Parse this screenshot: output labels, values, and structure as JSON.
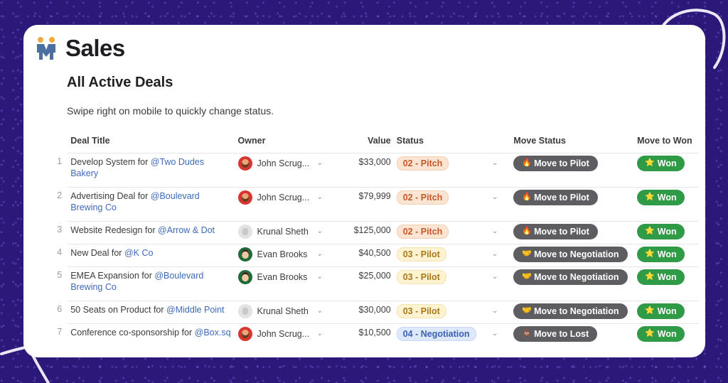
{
  "app": {
    "title": "Sales",
    "logo_icon": "handshake-people-icon"
  },
  "page": {
    "title": "All Active Deals",
    "subtitle": "Swipe right on mobile to quickly change status."
  },
  "table": {
    "columns": {
      "title": "Deal Title",
      "owner": "Owner",
      "value": "Value",
      "status": "Status",
      "move_status": "Move Status",
      "move_won": "Move to Won"
    },
    "rows": [
      {
        "num": "1",
        "title_prefix": "Develop System for ",
        "mention": "@Two Dudes Bakery",
        "owner": "John Scrug...",
        "owner_avatar": "john",
        "value": "$33,000",
        "status": "02 - Pitch",
        "status_kind": "pitch",
        "move_label": "Move to Pilot",
        "move_icon": "🔥",
        "won_label": "Won",
        "won_icon": "⭐"
      },
      {
        "num": "2",
        "title_prefix": "Advertising Deal for ",
        "mention": "@Boulevard Brewing Co",
        "owner": "John Scrug...",
        "owner_avatar": "john",
        "value": "$79,999",
        "status": "02 - Pitch",
        "status_kind": "pitch",
        "move_label": "Move to Pilot",
        "move_icon": "🔥",
        "won_label": "Won",
        "won_icon": "⭐"
      },
      {
        "num": "3",
        "title_prefix": "Website Redesign for ",
        "mention": "@Arrow & Dot",
        "owner": "Krunal Sheth",
        "owner_avatar": "krunal",
        "value": "$125,000",
        "status": "02 - Pitch",
        "status_kind": "pitch",
        "move_label": "Move to Pilot",
        "move_icon": "🔥",
        "won_label": "Won",
        "won_icon": "⭐"
      },
      {
        "num": "4",
        "title_prefix": "New Deal for ",
        "mention": "@K Co",
        "owner": "Evan Brooks",
        "owner_avatar": "evan",
        "value": "$40,500",
        "status": "03 - Pilot",
        "status_kind": "pilot",
        "move_label": "Move to Negotiation",
        "move_icon": "🤝",
        "won_label": "Won",
        "won_icon": "⭐"
      },
      {
        "num": "5",
        "title_prefix": "EMEA Expansion for ",
        "mention": "@Boulevard Brewing Co",
        "owner": "Evan Brooks",
        "owner_avatar": "evan",
        "value": "$25,000",
        "status": "03 - Pilot",
        "status_kind": "pilot",
        "move_label": "Move to Negotiation",
        "move_icon": "🤝",
        "won_label": "Won",
        "won_icon": "⭐"
      },
      {
        "num": "6",
        "title_prefix": "50 Seats on Product for ",
        "mention": "@Middle Point",
        "owner": "Krunal Sheth",
        "owner_avatar": "krunal",
        "value": "$30,000",
        "status": "03 - Pilot",
        "status_kind": "pilot",
        "move_label": "Move to Negotiation",
        "move_icon": "🤝",
        "won_label": "Won",
        "won_icon": "⭐"
      },
      {
        "num": "7",
        "title_prefix": "Conference co-sponsorship for ",
        "mention": "@Box.sq",
        "owner": "John Scrug...",
        "owner_avatar": "john",
        "value": "$10,500",
        "status": "04 - Negotiation",
        "status_kind": "neg",
        "move_label": "Move to Lost",
        "move_icon": "💩",
        "won_label": "Won",
        "won_icon": "⭐"
      }
    ]
  },
  "colors": {
    "background": "#2b1878",
    "pitch_text": "#c9582a",
    "pilot_text": "#a87a17",
    "negotiation_text": "#3d5fb0",
    "move_button": "#5e5e62",
    "won_button": "#2f9b47",
    "mention": "#3f6ab8"
  }
}
